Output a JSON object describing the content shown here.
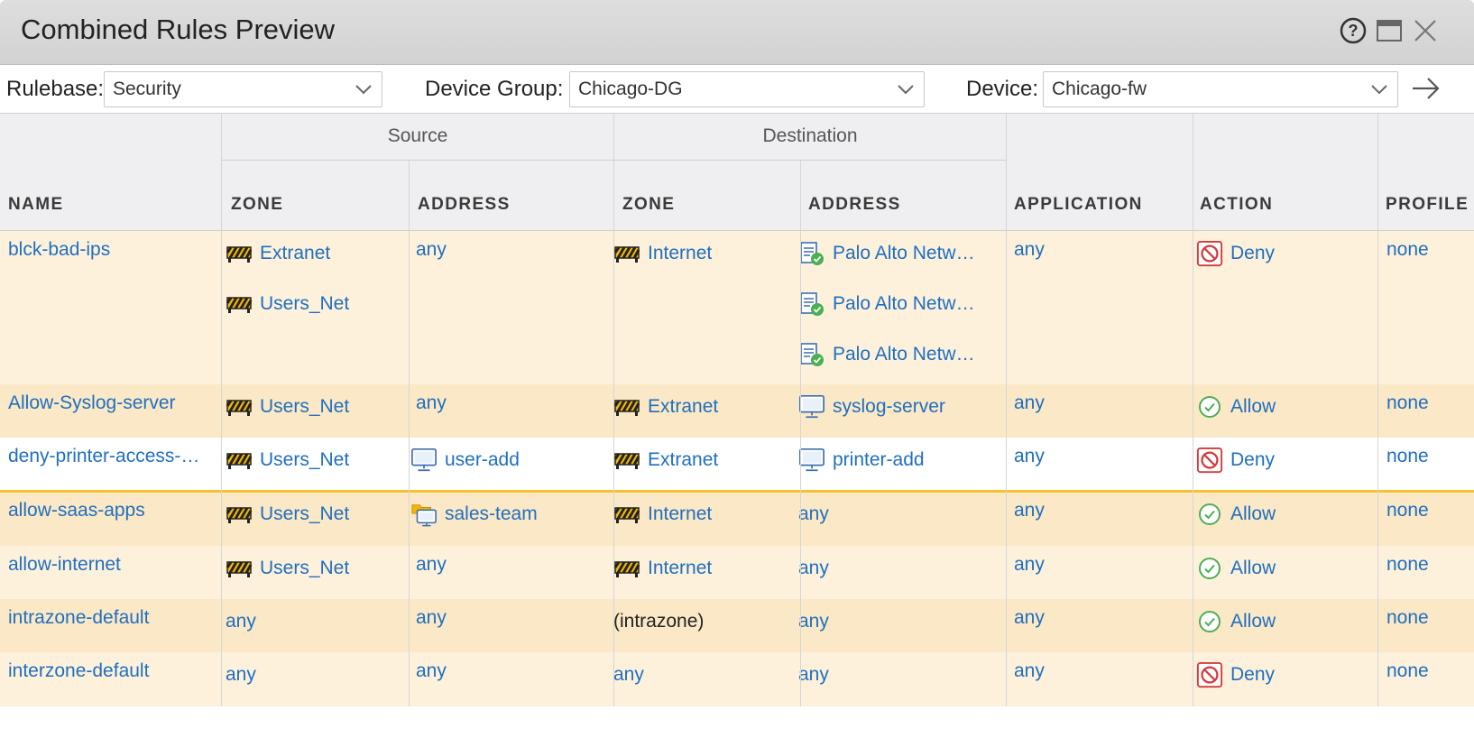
{
  "window": {
    "title": "Combined Rules Preview"
  },
  "toolbar": {
    "rulebase_label": "Rulebase:",
    "rulebase_value": "Security",
    "device_group_label": "Device Group:",
    "device_group_value": "Chicago-DG",
    "device_label": "Device:",
    "device_value": "Chicago-fw"
  },
  "table": {
    "groups": {
      "source": "Source",
      "destination": "Destination"
    },
    "columns": {
      "name": "NAME",
      "src_zone": "ZONE",
      "src_address": "ADDRESS",
      "dst_zone": "ZONE",
      "dst_address": "ADDRESS",
      "application": "APPLICATION",
      "action": "ACTION",
      "profile": "PROFILE"
    },
    "rows": [
      {
        "name": "blck-bad-ips",
        "src_zone": [
          "Extranet",
          "Users_Net"
        ],
        "src_address": "any",
        "dst_zone": [
          "Internet"
        ],
        "dst_address": [
          "Palo Alto Netw…",
          "Palo Alto Netw…",
          "Palo Alto Netw…"
        ],
        "application": "any",
        "action": "Deny",
        "profile": "none"
      },
      {
        "name": "Allow-Syslog-server",
        "src_zone": [
          "Users_Net"
        ],
        "src_address": "any",
        "dst_zone": [
          "Extranet"
        ],
        "dst_address": [
          "syslog-server"
        ],
        "application": "any",
        "action": "Allow",
        "profile": "none"
      },
      {
        "name": "deny-printer-access-…",
        "src_zone": [
          "Users_Net"
        ],
        "src_address": "user-add",
        "dst_zone": [
          "Extranet"
        ],
        "dst_address": [
          "printer-add"
        ],
        "application": "any",
        "action": "Deny",
        "profile": "none"
      },
      {
        "name": "allow-saas-apps",
        "src_zone": [
          "Users_Net"
        ],
        "src_address": "sales-team",
        "dst_zone": [
          "Internet"
        ],
        "dst_address": [
          "any"
        ],
        "application": "any",
        "action": "Allow",
        "profile": "none"
      },
      {
        "name": "allow-internet",
        "src_zone": [
          "Users_Net"
        ],
        "src_address": "any",
        "dst_zone": [
          "Internet"
        ],
        "dst_address": [
          "any"
        ],
        "application": "any",
        "action": "Allow",
        "profile": "none"
      },
      {
        "name": "intrazone-default",
        "src_zone": [
          "any"
        ],
        "src_address": "any",
        "dst_zone": [
          "(intrazone)"
        ],
        "dst_address": [
          "any"
        ],
        "application": "any",
        "action": "Allow",
        "profile": "none"
      },
      {
        "name": "interzone-default",
        "src_zone": [
          "any"
        ],
        "src_address": "any",
        "dst_zone": [
          "any"
        ],
        "dst_address": [
          "any"
        ],
        "application": "any",
        "action": "Deny",
        "profile": "none"
      }
    ]
  },
  "icons": {
    "zone": "zone-barrier-icon",
    "edl": "edl-list-icon",
    "address": "address-monitor-icon",
    "address_group": "address-group-icon",
    "allow": "allow-check-icon",
    "deny": "deny-block-icon"
  },
  "colors": {
    "link": "#1f6fbf",
    "row_light": "#fdf1dc",
    "row_dark": "#fbe8c6",
    "separator": "#f2c232",
    "allow": "#4caf50",
    "deny": "#d33a3a"
  }
}
